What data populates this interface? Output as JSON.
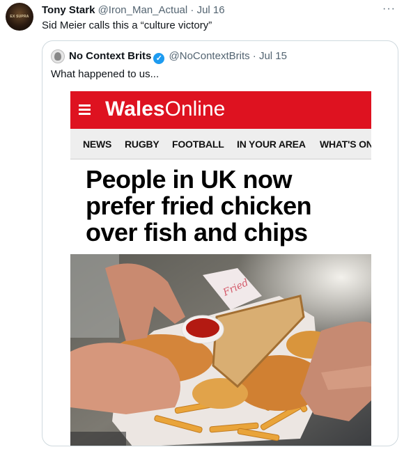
{
  "tweet": {
    "name": "Tony Stark",
    "handle": "@Iron_Man_Actual",
    "sep": "·",
    "date": "Jul 16",
    "text": "Sid Meier calls this a “culture victory”",
    "avatar_text": "EX SUPRA",
    "more_icon": "more-icon"
  },
  "quote": {
    "name": "No Context Brits",
    "handle": "@NoContextBrits",
    "sep": "·",
    "date": "Jul 15",
    "text": "What happened to us...",
    "verified_icon": "verified-badge-icon"
  },
  "screenshot": {
    "brand_bold": "Wales",
    "brand_light": "Online",
    "nav": [
      "NEWS",
      "RUGBY",
      "FOOTBALL",
      "IN YOUR AREA",
      "WHAT'S ON"
    ],
    "headline": "People in UK now prefer fried chicken over fish and chips",
    "bar_color": "#de1220"
  }
}
